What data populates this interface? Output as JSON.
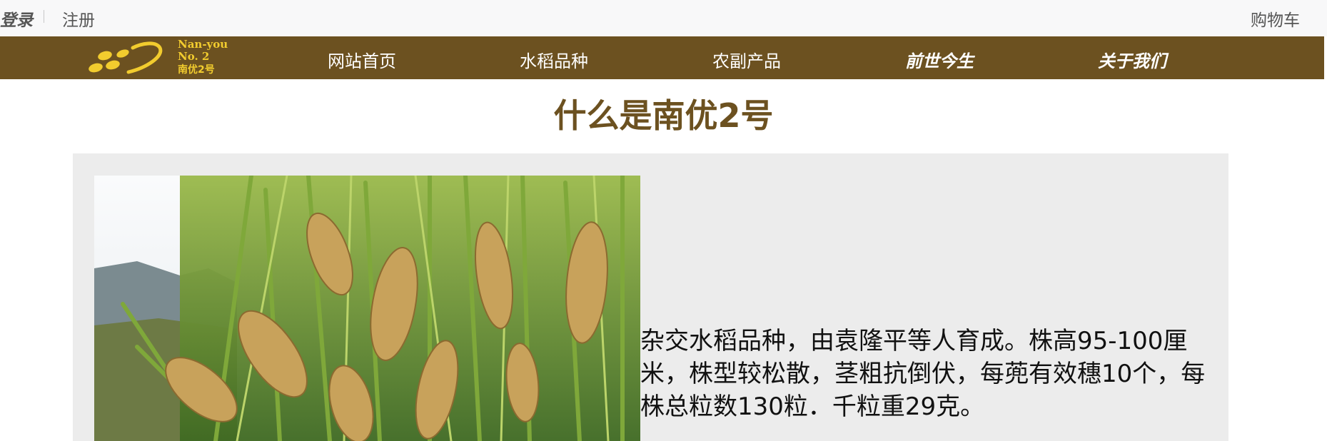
{
  "topbar": {
    "login": "登录",
    "register": "注册",
    "cart": "购物车"
  },
  "logo": {
    "line1": "Nan-you",
    "line2": "No. 2",
    "line3": "南优2号",
    "color": "#f2cc2e"
  },
  "nav": {
    "items": [
      {
        "label": "网站首页",
        "style": "normal"
      },
      {
        "label": "水稻品种",
        "style": "normal"
      },
      {
        "label": "农副产品",
        "style": "normal"
      },
      {
        "label": "前世今生",
        "style": "bold-italic"
      },
      {
        "label": "关于我们",
        "style": "bold-italic"
      }
    ]
  },
  "page": {
    "title": "什么是南优2号",
    "description": "杂交水稻品种，由袁隆平等人育成。株高95-100厘米，株型较松散，茎粗抗倒伏，每蔸有效穗10个，每株总粒数130粒．千粒重29克。"
  },
  "colors": {
    "brand": "#6c5120",
    "panel": "#ececec",
    "topbar": "#f8f8f9"
  }
}
